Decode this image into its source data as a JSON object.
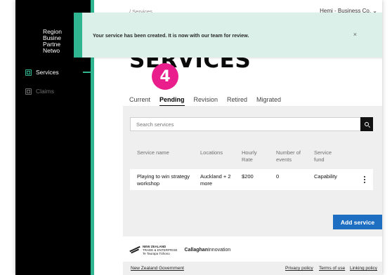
{
  "breadcrumb": "/ Services",
  "account": {
    "name": "Hemi - Business Co.",
    "chevron": "chevron-down-icon"
  },
  "brand": [
    "Region",
    "Busine",
    "Partne",
    "Netwo"
  ],
  "sidebar": {
    "items": [
      {
        "label": "Services",
        "icon": "services-icon",
        "active": true
      },
      {
        "label": "Claims",
        "icon": "claims-icon",
        "active": false
      }
    ]
  },
  "toast": {
    "message": "Your service has been created. It is now with our team for review.",
    "close": "×"
  },
  "page_title": "SERVICES",
  "step_badge": "4",
  "tabs": [
    "Current",
    "Pending",
    "Revision",
    "Retired",
    "Migrated"
  ],
  "active_tab": "Pending",
  "search": {
    "placeholder": "Search services"
  },
  "table": {
    "headers": [
      "Service name",
      "Locations",
      "Hourly Rate",
      "Number of events",
      "Service fund"
    ],
    "rows": [
      {
        "service_name": "Playing to win strategy workshop",
        "locations": "Auckland + 2 more",
        "hourly_rate": "$200",
        "events": "0",
        "fund": "Capability"
      }
    ]
  },
  "add_button": "Add service",
  "footer": {
    "nz_logo_line1": "NEW ZEALAND",
    "nz_logo_line2": "TRADE & ENTERPRISE",
    "nz_logo_line3": "Te Taurapa Tūhono",
    "callaghan_bold": "Callaghan",
    "callaghan_light": "Innovation",
    "gov": "New Zealand Government",
    "links": [
      "Privacy policy",
      "Terms of use",
      "Linking policy"
    ]
  },
  "colors": {
    "accent": "#2fb58f",
    "primary_button": "#1e6fc2",
    "badge": "#e91e8c",
    "toast_bg": "#daf0e8"
  }
}
